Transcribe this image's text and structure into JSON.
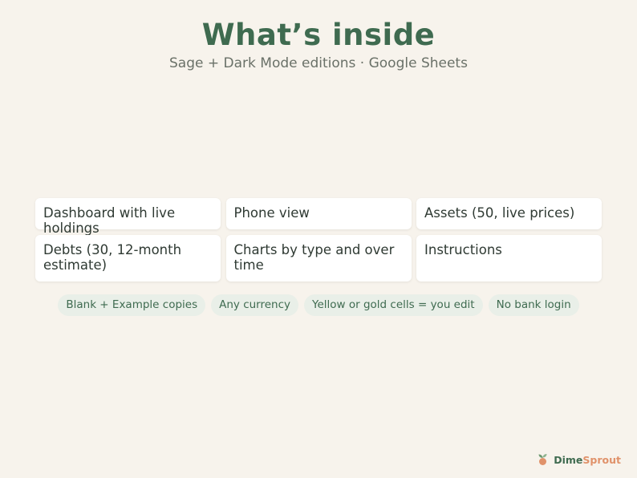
{
  "header": {
    "title": "What’s inside",
    "subtitle": "Sage + Dark Mode editions · Google Sheets"
  },
  "features": [
    "Dashboard with live holdings",
    "Phone view",
    "Assets (50, live prices)",
    "Debts (30, 12-month estimate)",
    "Charts by type and over time",
    "Instructions"
  ],
  "chips": [
    "Blank + Example copies",
    "Any currency",
    "Yellow or gold cells = you edit",
    "No bank login"
  ],
  "brand": {
    "part1": "Dime",
    "part2": "Sprout",
    "icon": "sprout-icon",
    "colors": {
      "primary": "#3f6b50",
      "accent": "#e0926a"
    }
  }
}
